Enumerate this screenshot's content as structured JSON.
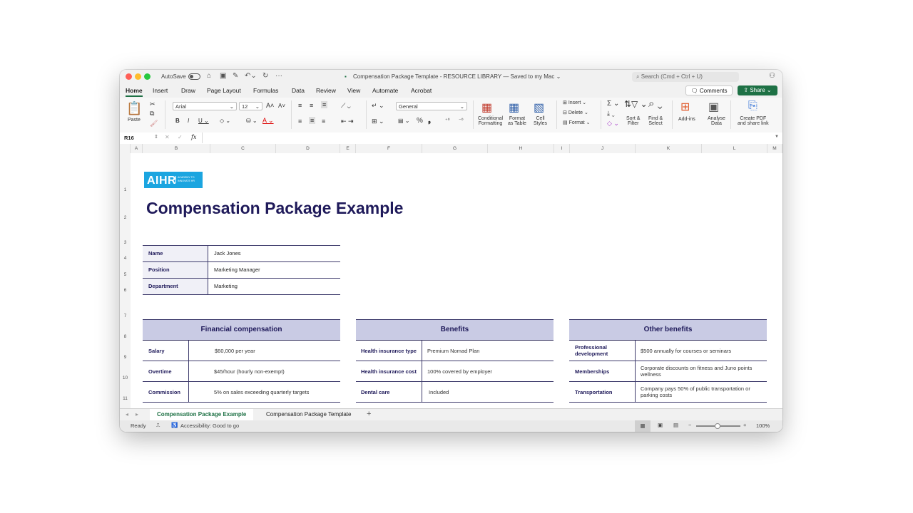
{
  "titlebar": {
    "autosave": "AutoSave",
    "title": "Compensation Package Template - RESOURCE LIBRARY — Saved to my Mac ⌄",
    "search_placeholder": "Search (Cmd + Ctrl + U)"
  },
  "menu": {
    "tabs": [
      "Home",
      "Insert",
      "Draw",
      "Page Layout",
      "Formulas",
      "Data",
      "Review",
      "View",
      "Automate",
      "Acrobat"
    ],
    "active": "Home",
    "comments": "Comments",
    "share": "Share"
  },
  "ribbon": {
    "paste": "Paste",
    "font": "Arial",
    "font_size": "12",
    "number_format": "General",
    "conditional": [
      "Conditional",
      "Formatting"
    ],
    "format_table": [
      "Format",
      "as Table"
    ],
    "cell_styles": [
      "Cell",
      "Styles"
    ],
    "insert": "Insert",
    "delete": "Delete",
    "format": "Format",
    "sort": [
      "Sort &",
      "Filter"
    ],
    "find": [
      "Find &",
      "Select"
    ],
    "addins": "Add-ins",
    "analyse": [
      "Analyse",
      "Data"
    ],
    "pdf": [
      "Create PDF",
      "and share link"
    ]
  },
  "formula_bar": {
    "name_box": "R16",
    "fx": "fx",
    "content": ""
  },
  "columns": [
    "A",
    "B",
    "C",
    "D",
    "E",
    "F",
    "G",
    "H",
    "I",
    "J",
    "K",
    "L",
    "M"
  ],
  "rows": [
    "1",
    "2",
    "3",
    "4",
    "5",
    "6",
    "7",
    "8",
    "9",
    "10",
    "11"
  ],
  "sheet": {
    "logo_text": "AIHR",
    "logo_sub": "ACADEMY TO INNOVATE HR",
    "title": "Compensation Package Example",
    "info": [
      {
        "label": "Name",
        "value": "Jack Jones"
      },
      {
        "label": "Position",
        "value": "Marketing Manager"
      },
      {
        "label": "Department",
        "value": "Marketing"
      }
    ],
    "financial": {
      "title": "Financial compensation",
      "rows": [
        {
          "label": "Salary",
          "value": "$60,000 per year"
        },
        {
          "label": "Overtime",
          "value": "$45/hour (hourly non-exempt)"
        },
        {
          "label": "Commission",
          "value": "5% on sales exceeding quarterly targets"
        }
      ]
    },
    "benefits": {
      "title": "Benefits",
      "rows": [
        {
          "label": "Health insurance type",
          "value": "Premium Nomad Plan"
        },
        {
          "label": "Health insurance cost",
          "value": "100% covered by employer"
        },
        {
          "label": "Dental care",
          "value": "Included"
        }
      ]
    },
    "other": {
      "title": "Other benefits",
      "rows": [
        {
          "label": "Professional development",
          "value": "$500 annually for courses or seminars"
        },
        {
          "label": "Memberships",
          "value": "Corporate discounts on fitness and Juno points wellness"
        },
        {
          "label": "Transportation",
          "value": "Company pays 50% of public transportation or parking costs"
        }
      ]
    }
  },
  "sheet_tabs": [
    "Compensation Package Example",
    "Compensation Package Template"
  ],
  "status": {
    "ready": "Ready",
    "accessibility": "Accessibility: Good to go",
    "zoom": "100%"
  },
  "colors": {
    "accent_green": "#1e7145",
    "header_fill": "#c9cbe4",
    "title_navy": "#1f1a5a",
    "logo_blue": "#1ba5e0"
  }
}
